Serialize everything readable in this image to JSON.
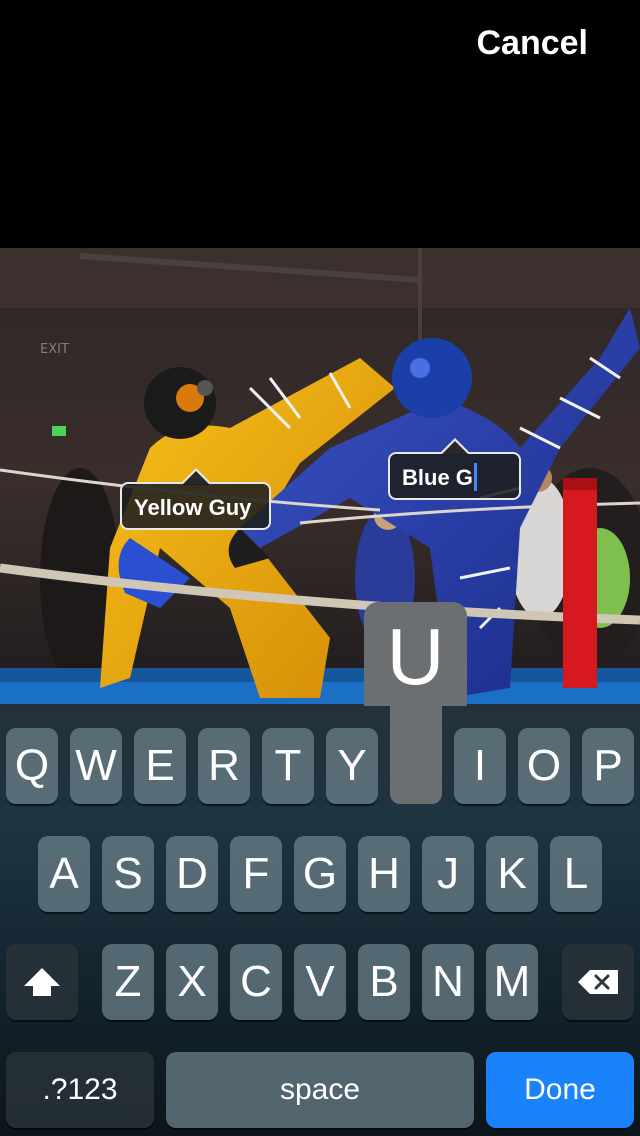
{
  "header": {
    "cancel_label": "Cancel"
  },
  "photo": {
    "tags": [
      {
        "label": "Yellow Guy"
      },
      {
        "label": "Blue G",
        "editing": true
      }
    ],
    "scene_labels": {
      "exit_sign": "EXIT"
    }
  },
  "keyboard": {
    "pressed_key": "U",
    "rows": [
      [
        "Q",
        "W",
        "E",
        "R",
        "T",
        "Y",
        "U",
        "I",
        "O",
        "P"
      ],
      [
        "A",
        "S",
        "D",
        "F",
        "G",
        "H",
        "J",
        "K",
        "L"
      ],
      [
        "Z",
        "X",
        "C",
        "V",
        "B",
        "N",
        "M"
      ]
    ],
    "shift_icon": "shift-arrow-icon",
    "delete_icon": "backspace-icon",
    "mode_label": ".?123",
    "space_label": "space",
    "done_label": "Done",
    "colors": {
      "done": "#1a82fb",
      "caret": "#3d8af7"
    }
  }
}
